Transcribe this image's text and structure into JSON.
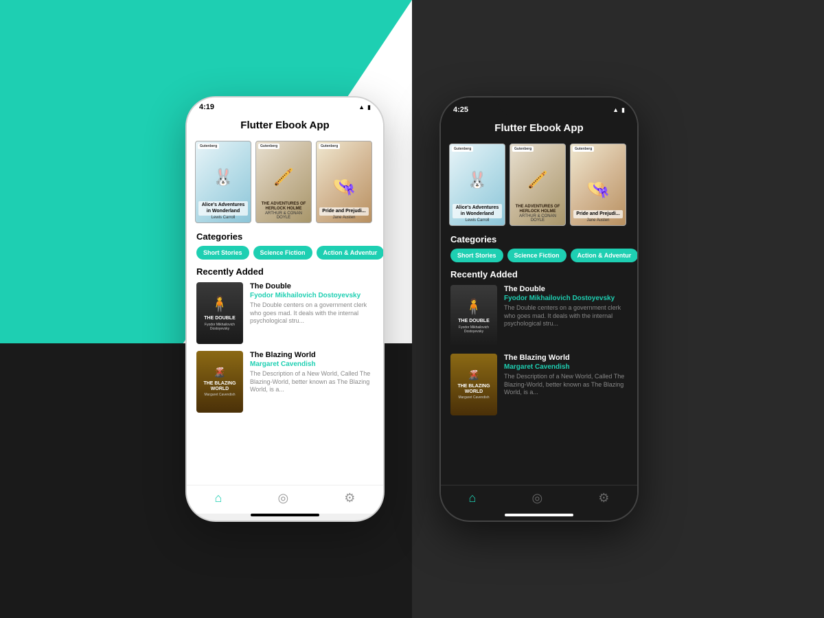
{
  "background": {
    "accent_color": "#1ECFB2",
    "dark_color": "#2a2a2a"
  },
  "phone_light": {
    "status_time": "4:19",
    "app_title": "Flutter Ebook App",
    "categories_label": "Categories",
    "recently_added_label": "Recently Added",
    "categories": [
      "Short Stories",
      "Science Fiction",
      "Action & Adventur"
    ],
    "books_carousel": [
      {
        "title": "Alice's Adventures in Wonderland",
        "author": "Lewis Carroll"
      },
      {
        "title": "The Adventures of Sherlock Holmes",
        "author": "Arthur Conan Doyle"
      },
      {
        "title": "Pride and Prejudice",
        "author": "Jane Austen"
      }
    ],
    "recently_added": [
      {
        "title": "The Double",
        "author": "Fyodor Mikhailovich Dostoyevsky",
        "description": "The Double centers on a government clerk who goes mad. It deals with the internal psychological stru..."
      },
      {
        "title": "The Blazing World",
        "author": "Margaret Cavendish",
        "description": "The Description of a New World, Called The Blazing-World, better known as The Blazing World, is a..."
      }
    ],
    "nav": {
      "home": "🏠",
      "explore": "🧭",
      "settings": "⚙️"
    }
  },
  "phone_dark": {
    "status_time": "4:25",
    "app_title": "Flutter Ebook App",
    "categories_label": "Categories",
    "recently_added_label": "Recently Added",
    "categories": [
      "Short Stories",
      "Science Fiction",
      "Action & Adventur"
    ],
    "books_carousel": [
      {
        "title": "Alice's Adventures in Wonderland",
        "author": "Lewis Carroll"
      },
      {
        "title": "The Adventures of Sherlock Holmes",
        "author": "Arthur Conan Doyle"
      },
      {
        "title": "Pride and Prejudice",
        "author": "Jane Austen"
      }
    ],
    "recently_added": [
      {
        "title": "The Double",
        "author": "Fyodor Mikhailovich Dostoyevsky",
        "description": "The Double centers on a government clerk who goes mad. It deals with the internal psychological stru..."
      },
      {
        "title": "The Blazing World",
        "author": "Margaret Cavendish",
        "description": "The Description of a New World, Called The Blazing-World, better known as The Blazing World, is a..."
      }
    ]
  },
  "icons": {
    "wifi": "▲",
    "battery": "▮",
    "home_nav": "⌂",
    "compass_nav": "◎",
    "gear_nav": "⚙"
  }
}
